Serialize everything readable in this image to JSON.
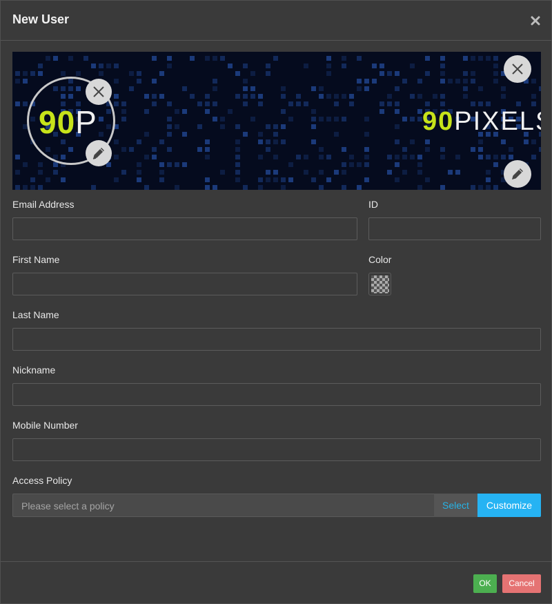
{
  "dialog": {
    "title": "New User"
  },
  "banner": {
    "logo_small": {
      "lime": "90",
      "white": "P"
    },
    "logo_big": {
      "lime": "90",
      "white": "PIXELS"
    }
  },
  "form": {
    "email": {
      "label": "Email Address",
      "value": ""
    },
    "id": {
      "label": "ID",
      "value": ""
    },
    "first_name": {
      "label": "First Name",
      "value": ""
    },
    "color": {
      "label": "Color"
    },
    "last_name": {
      "label": "Last Name",
      "value": ""
    },
    "nickname": {
      "label": "Nickname",
      "value": ""
    },
    "mobile": {
      "label": "Mobile Number",
      "value": ""
    },
    "access_policy": {
      "label": "Access Policy",
      "placeholder": "Please select a policy",
      "select_label": "Select",
      "customize_label": "Customize"
    }
  },
  "footer": {
    "ok_label": "OK",
    "cancel_label": "Cancel"
  },
  "colors": {
    "ok": "#4caf50",
    "cancel": "#e57373",
    "accent": "#26b3f3",
    "logo_lime": "#c7e31a"
  }
}
